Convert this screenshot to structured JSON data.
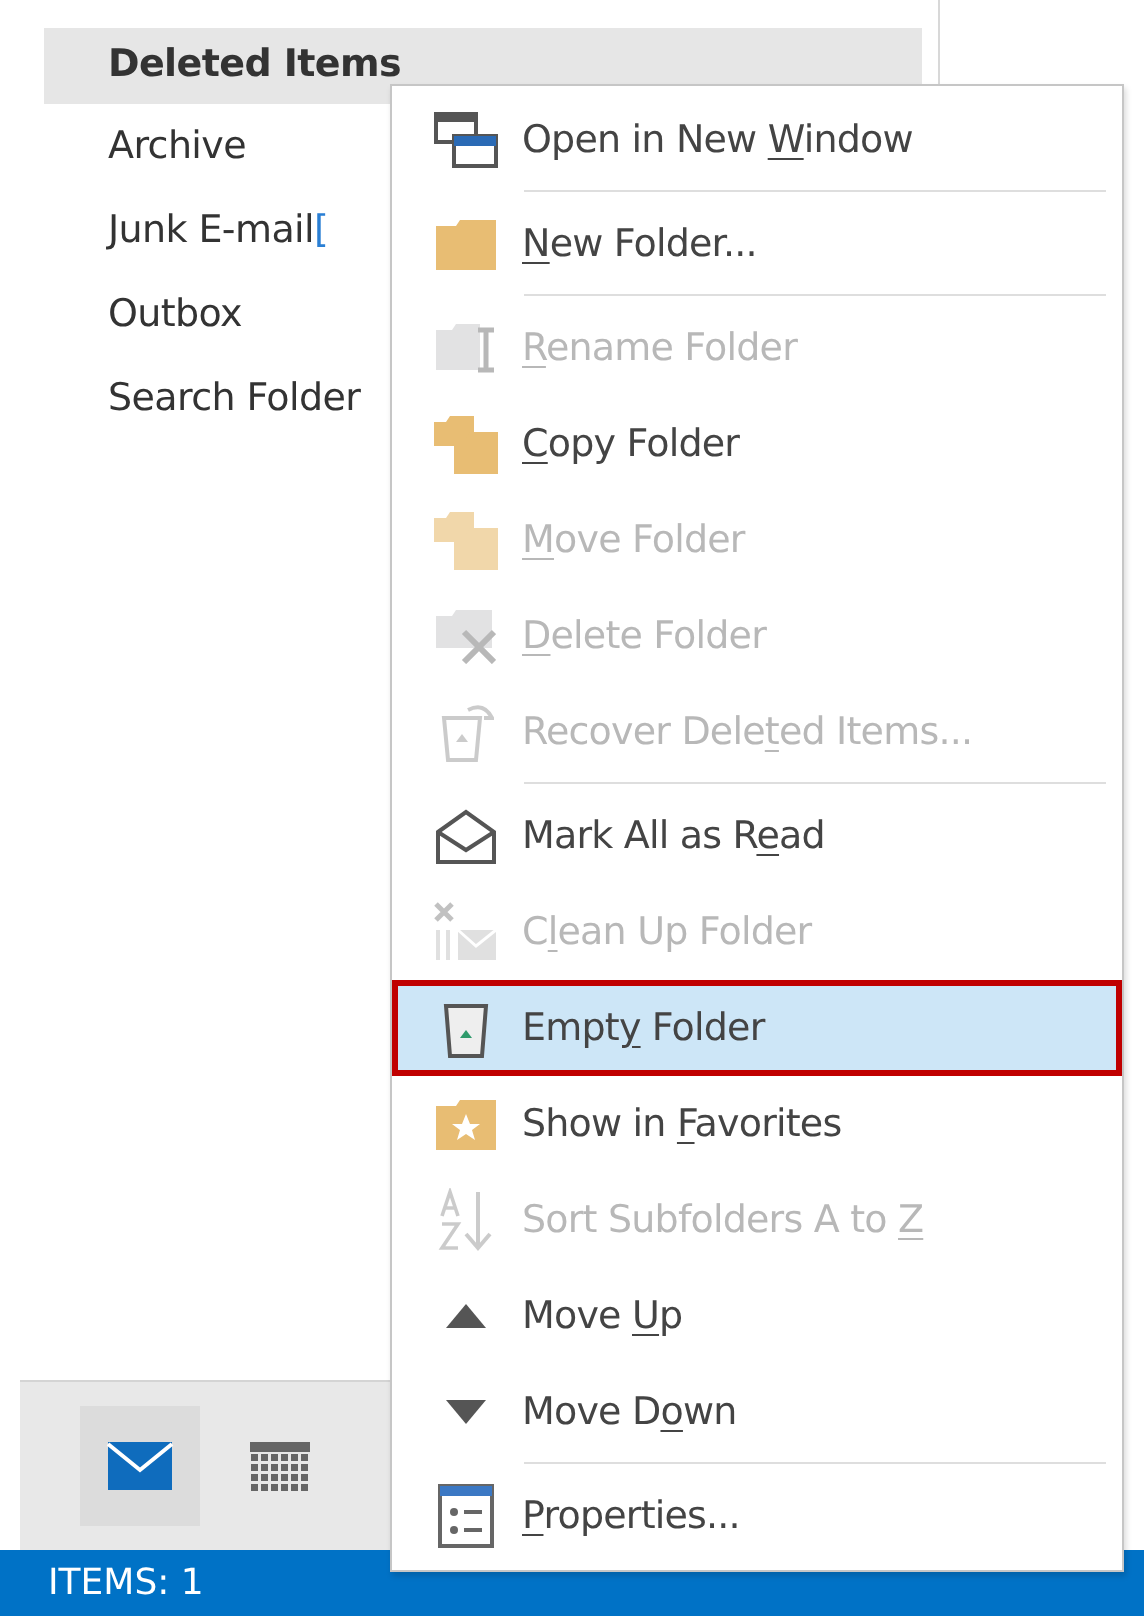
{
  "folders": [
    {
      "name": "Deleted Items",
      "selected": true
    },
    {
      "name": "Archive",
      "selected": false
    },
    {
      "name": "Junk E-mail",
      "count": "[",
      "selected": false
    },
    {
      "name": "Outbox",
      "selected": false
    },
    {
      "name": "Search Folder",
      "selected": false
    }
  ],
  "context_menu": [
    {
      "kind": "item",
      "disabled": false,
      "selected": false,
      "label": [
        {
          "text": "Open in New ",
          "underline": false
        },
        {
          "text": "W",
          "underline": true
        },
        {
          "text": "indow",
          "underline": false
        }
      ]
    },
    {
      "kind": "separator"
    },
    {
      "kind": "item",
      "disabled": false,
      "selected": false,
      "label": [
        {
          "text": "N",
          "underline": true
        },
        {
          "text": "ew Folder...",
          "underline": false
        }
      ]
    },
    {
      "kind": "separator"
    },
    {
      "kind": "item",
      "disabled": true,
      "selected": false,
      "label": [
        {
          "text": "R",
          "underline": true
        },
        {
          "text": "ename Folder",
          "underline": false
        }
      ]
    },
    {
      "kind": "item",
      "disabled": false,
      "selected": false,
      "label": [
        {
          "text": "C",
          "underline": true
        },
        {
          "text": "opy Folder",
          "underline": false
        }
      ]
    },
    {
      "kind": "item",
      "disabled": true,
      "selected": false,
      "label": [
        {
          "text": "M",
          "underline": true
        },
        {
          "text": "ove Folder",
          "underline": false
        }
      ]
    },
    {
      "kind": "item",
      "disabled": true,
      "selected": false,
      "label": [
        {
          "text": "D",
          "underline": true
        },
        {
          "text": "elete Folder",
          "underline": false
        }
      ]
    },
    {
      "kind": "item",
      "disabled": true,
      "selected": false,
      "label": [
        {
          "text": "Recover Dele",
          "underline": false
        },
        {
          "text": "t",
          "underline": true
        },
        {
          "text": "ed Items...",
          "underline": false
        }
      ]
    },
    {
      "kind": "separator"
    },
    {
      "kind": "item",
      "disabled": false,
      "selected": false,
      "label": [
        {
          "text": "Mark All as R",
          "underline": false
        },
        {
          "text": "e",
          "underline": true
        },
        {
          "text": "ad",
          "underline": false
        }
      ]
    },
    {
      "kind": "item",
      "disabled": true,
      "selected": false,
      "label": [
        {
          "text": "C",
          "underline": false
        },
        {
          "text": "l",
          "underline": true
        },
        {
          "text": "ean Up Folder",
          "underline": false
        }
      ]
    },
    {
      "kind": "item",
      "disabled": false,
      "selected": true,
      "outlined": true,
      "label": [
        {
          "text": "Empt",
          "underline": false
        },
        {
          "text": "y",
          "underline": true
        },
        {
          "text": " Folder",
          "underline": false
        }
      ]
    },
    {
      "kind": "item",
      "disabled": false,
      "selected": false,
      "label": [
        {
          "text": "Show in ",
          "underline": false
        },
        {
          "text": "F",
          "underline": true
        },
        {
          "text": "avorites",
          "underline": false
        }
      ]
    },
    {
      "kind": "item",
      "disabled": true,
      "selected": false,
      "label": [
        {
          "text": "Sort Subfolders A to ",
          "underline": false
        },
        {
          "text": "Z",
          "underline": true
        }
      ]
    },
    {
      "kind": "item",
      "disabled": false,
      "selected": false,
      "label": [
        {
          "text": "Move ",
          "underline": false
        },
        {
          "text": "U",
          "underline": true
        },
        {
          "text": "p",
          "underline": false
        }
      ]
    },
    {
      "kind": "item",
      "disabled": false,
      "selected": false,
      "label": [
        {
          "text": "Move D",
          "underline": false
        },
        {
          "text": "o",
          "underline": true
        },
        {
          "text": "wn",
          "underline": false
        }
      ]
    },
    {
      "kind": "separator"
    },
    {
      "kind": "item",
      "disabled": false,
      "selected": false,
      "label": [
        {
          "text": "P",
          "underline": true
        },
        {
          "text": "roperties...",
          "underline": false
        }
      ]
    }
  ],
  "nav": [
    {
      "selected": true
    },
    {
      "selected": false
    }
  ],
  "status_bar": "ITEMS: 1"
}
